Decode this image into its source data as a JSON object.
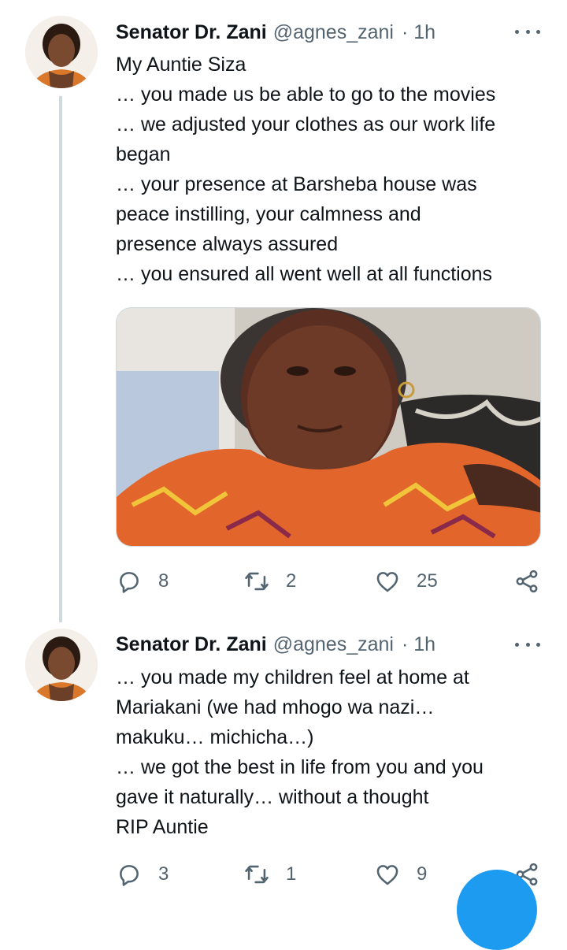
{
  "tweets": [
    {
      "name": "Senator Dr. Zani",
      "handle": "@agnes_zani",
      "time": "· 1h",
      "lines": [
        "My Auntie Siza",
        "… you made us be able to go to the movies",
        "… we adjusted your clothes as our work life",
        "began",
        "… your presence at Barsheba house was",
        "peace instilling, your calmness and",
        "presence always assured",
        "… you ensured all went well at all functions"
      ],
      "replies": "8",
      "retweets": "2",
      "likes": "25"
    },
    {
      "name": "Senator Dr. Zani",
      "handle": "@agnes_zani",
      "time": "· 1h",
      "lines": [
        "… you made my children feel at home at",
        "Mariakani (we had mhogo wa nazi…",
        "makuku… michicha…)",
        "… we got the best in life from you and you",
        "gave it naturally… without a thought",
        "RIP Auntie"
      ],
      "replies": "3",
      "retweets": "1",
      "likes": "9"
    }
  ],
  "colors": {
    "text": "#0f1419",
    "secondary": "#536471",
    "accent": "#1d9bf0",
    "thread": "#cfd9de"
  },
  "icons": [
    "reply-icon",
    "retweet-icon",
    "like-icon",
    "share-icon",
    "more-icon"
  ]
}
